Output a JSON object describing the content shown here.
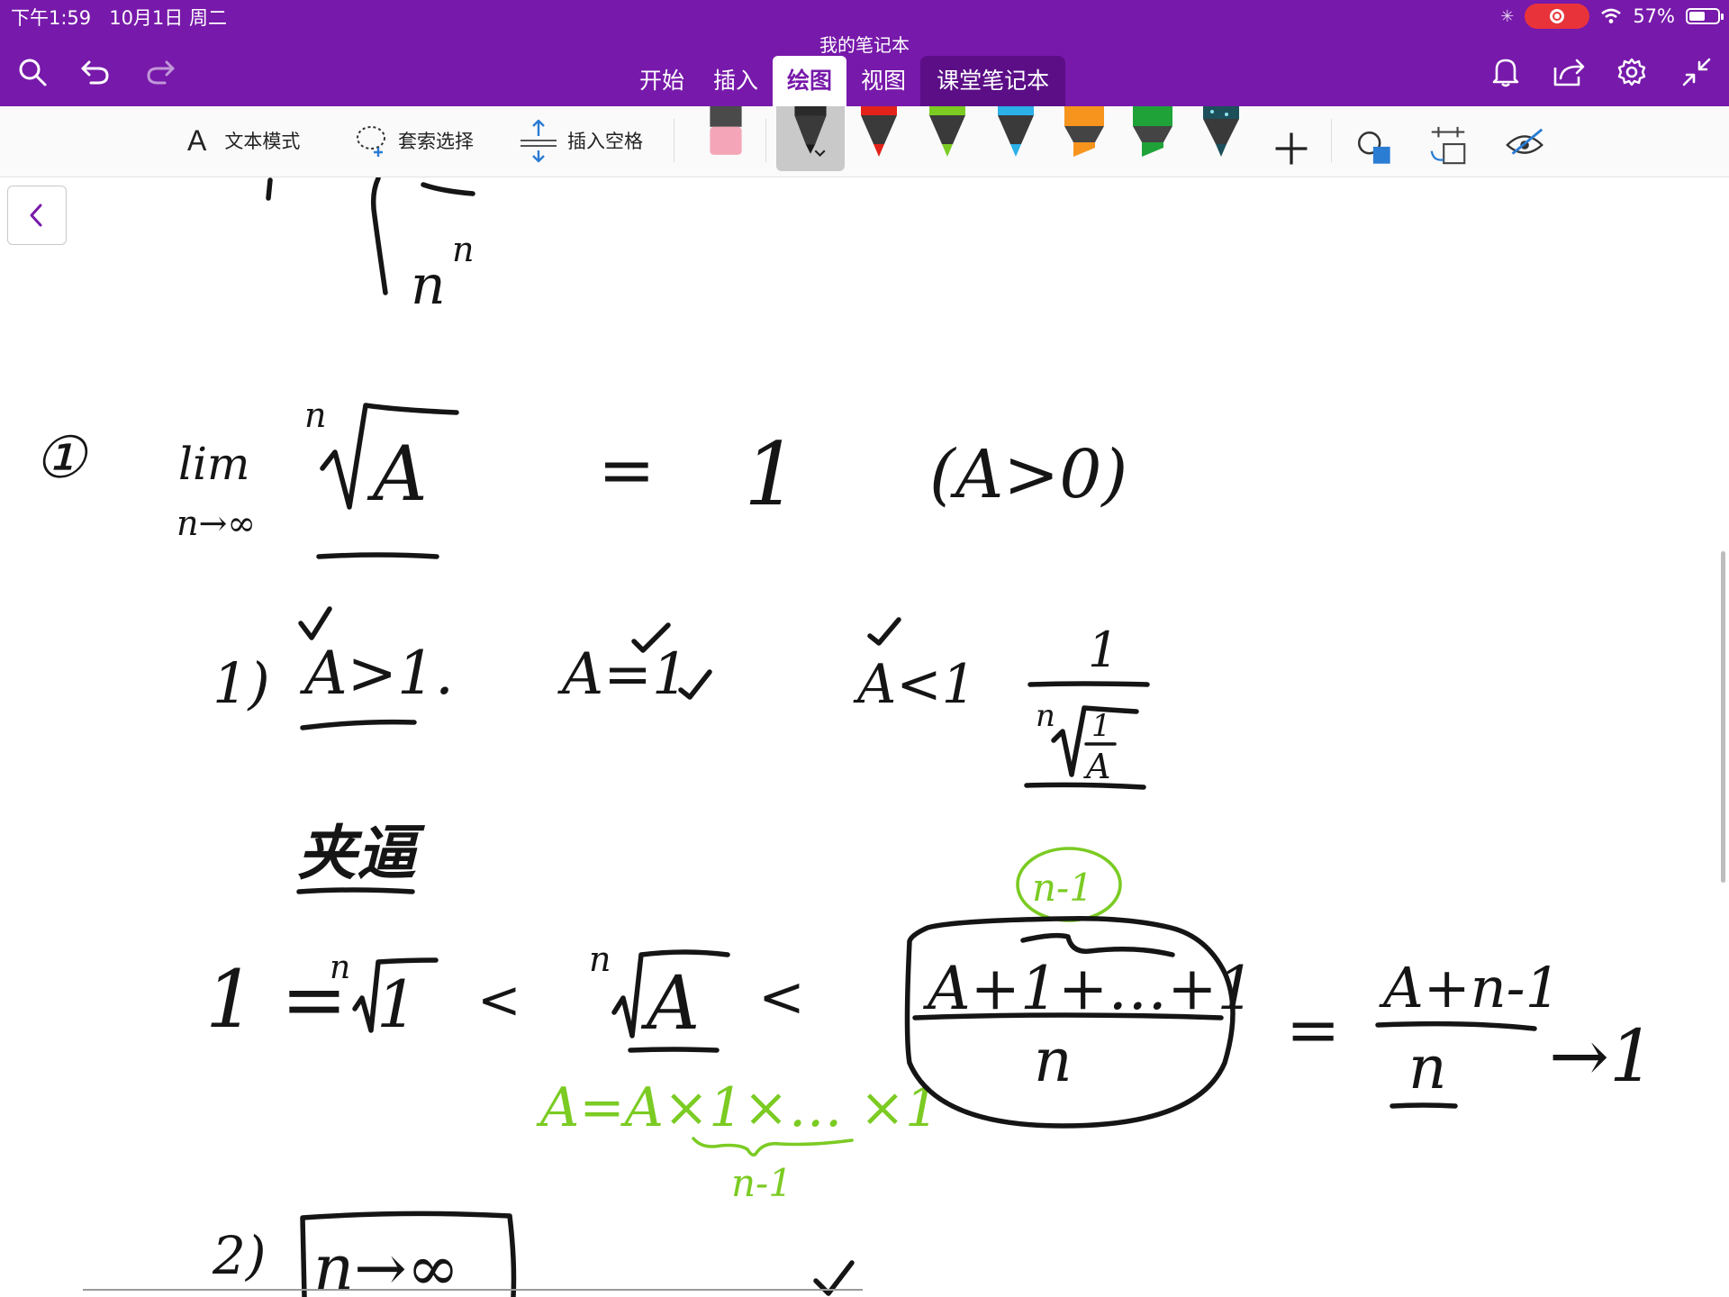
{
  "status_bar": {
    "time": "下午1:59",
    "date": "10月1日 周二",
    "battery_percent": "57%",
    "battery_level": 0.57
  },
  "window": {
    "notebook_title": "我的笔记本"
  },
  "tabs": [
    {
      "label": "开始"
    },
    {
      "label": "插入"
    },
    {
      "label": "绘图",
      "active": true
    },
    {
      "label": "视图"
    },
    {
      "label": "课堂笔记本"
    }
  ],
  "ribbon": {
    "text_mode_icon": "A",
    "text_mode_label": "文本模式",
    "lasso_label": "套索选择",
    "insert_space_label": "插入空格",
    "pens": [
      {
        "name": "black-pen",
        "color": "#1A1A1A"
      },
      {
        "name": "red-pen",
        "color": "#E2231A"
      },
      {
        "name": "green-pen",
        "color": "#7BCB23"
      },
      {
        "name": "blue-pen",
        "color": "#2BB0E8"
      },
      {
        "name": "orange-highlighter",
        "color": "#F7941D"
      },
      {
        "name": "green-highlighter",
        "color": "#1FA339"
      },
      {
        "name": "galaxy-pen",
        "color": "#1C4F5A"
      }
    ]
  },
  "colors": {
    "accent": "#7719AA",
    "ink": "#151515",
    "green_ink": "#7BCB23"
  },
  "ink": {
    "top_n_power": "n",
    "top_n": "n",
    "item_number": "①",
    "lim": "lim",
    "lim_sub": "n→∞",
    "root_index": "n",
    "root_A": "A",
    "equals": "=",
    "one": "1",
    "condition": "(A>0)",
    "case_num_1": "1)",
    "case_gt": "A>1.",
    "case_eq": "A=1",
    "case_lt": "A<1",
    "frac_num": "1",
    "frac_den_index": "n",
    "frac_den_num": "1",
    "frac_den_A": "A",
    "squeeze_title": "夹逼",
    "ineq_left": "1 =",
    "ineq_root_index": "n",
    "ineq_root_one": "1",
    "lt1": "<",
    "ineq_root2_index": "n",
    "ineq_root2_A": "A",
    "lt2": "<",
    "green_expansion": "A=A×1×… ×1",
    "green_n_minus_1_bottom": "n-1",
    "green_n_minus_1_top": "n-1",
    "am_numerator": "A+1+…+1",
    "am_denominator": "n",
    "eq2": "=",
    "result_numerator": "A+n-1",
    "result_denominator": "n",
    "arrow_to": "→1",
    "case_num_2": "2)",
    "case2_box": "n→∞"
  }
}
